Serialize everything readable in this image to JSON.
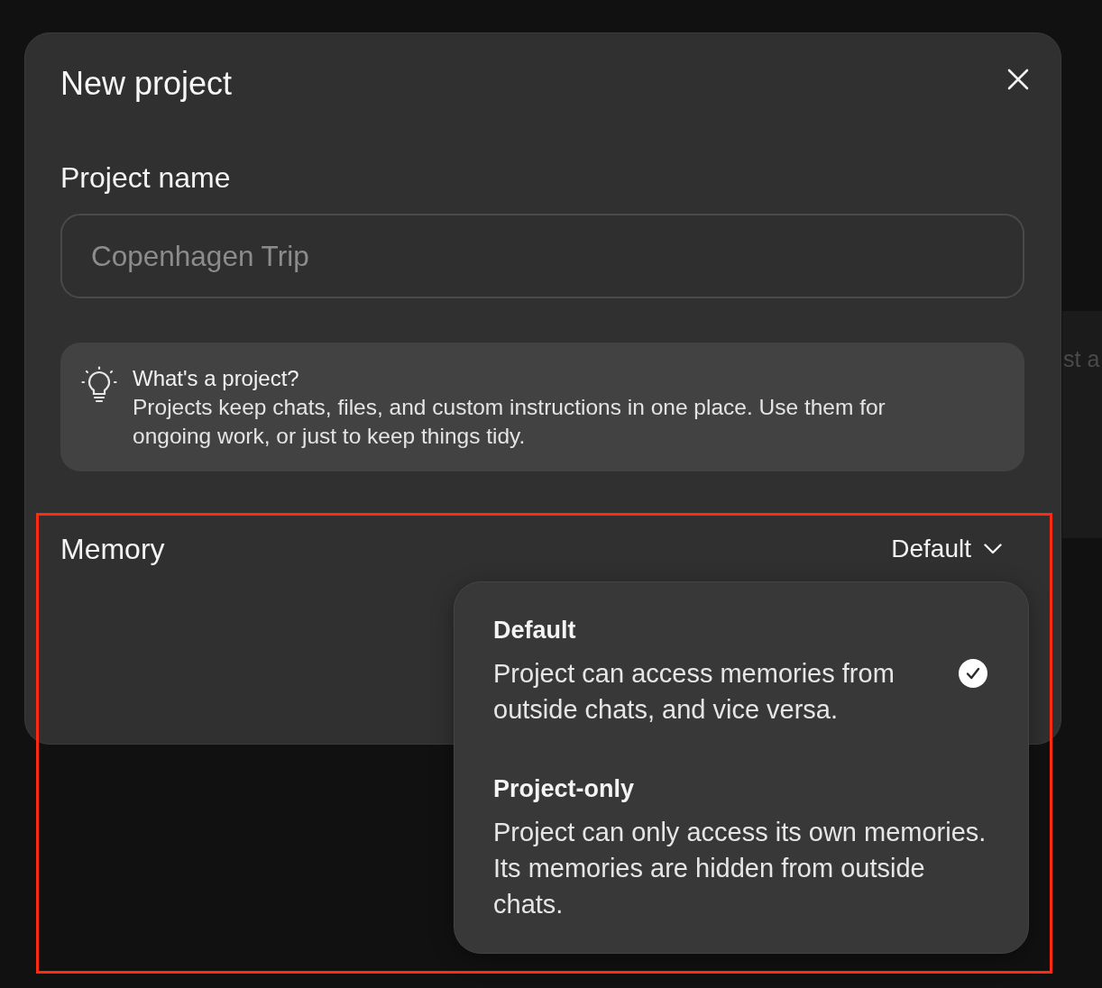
{
  "background": {
    "text": "st a"
  },
  "dialog": {
    "title": "New project",
    "name_field": {
      "label": "Project name",
      "placeholder": "Copenhagen Trip"
    },
    "info": {
      "title": "What's a project?",
      "text": "Projects keep chats, files, and custom instructions in one place. Use them for ongoing work, or just to keep things tidy."
    },
    "memory": {
      "label": "Memory",
      "value": "Default",
      "expanded": true,
      "options": [
        {
          "title": "Default",
          "description": "Project can access memories from outside chats, and vice versa.",
          "selected": true
        },
        {
          "title": "Project-only",
          "description": "Project can only access its own memories. Its memories are hidden from outside chats.",
          "selected": false
        }
      ]
    }
  }
}
